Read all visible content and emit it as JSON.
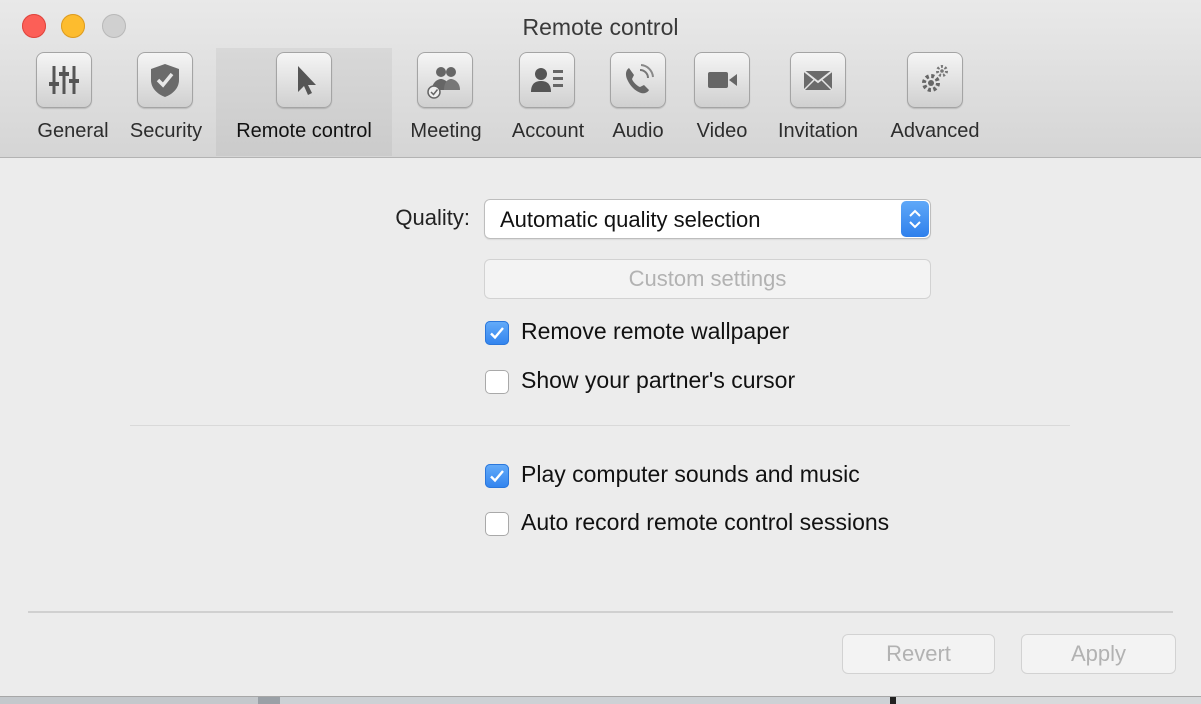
{
  "window": {
    "title": "Remote control"
  },
  "tabs": [
    {
      "label": "General",
      "icon": "sliders-icon"
    },
    {
      "label": "Security",
      "icon": "shield-icon"
    },
    {
      "label": "Remote control",
      "icon": "cursor-icon",
      "selected": true
    },
    {
      "label": "Meeting",
      "icon": "people-icon"
    },
    {
      "label": "Account",
      "icon": "contact-card-icon"
    },
    {
      "label": "Audio",
      "icon": "phone-icon"
    },
    {
      "label": "Video",
      "icon": "video-camera-icon"
    },
    {
      "label": "Invitation",
      "icon": "envelope-icon"
    },
    {
      "label": "Advanced",
      "icon": "gears-icon"
    }
  ],
  "quality": {
    "label": "Quality:",
    "selected": "Automatic quality selection"
  },
  "custom_settings_label": "Custom settings",
  "options": [
    {
      "label": "Remove remote wallpaper",
      "checked": true
    },
    {
      "label": "Show your partner's cursor",
      "checked": false
    },
    {
      "label": "Play computer sounds and music",
      "checked": true
    },
    {
      "label": "Auto record remote control sessions",
      "checked": false
    }
  ],
  "footer": {
    "revert_label": "Revert",
    "apply_label": "Apply"
  },
  "colors": {
    "accent": "#3183ee",
    "close": "#fc5f57",
    "minimize": "#fdbc2e"
  }
}
